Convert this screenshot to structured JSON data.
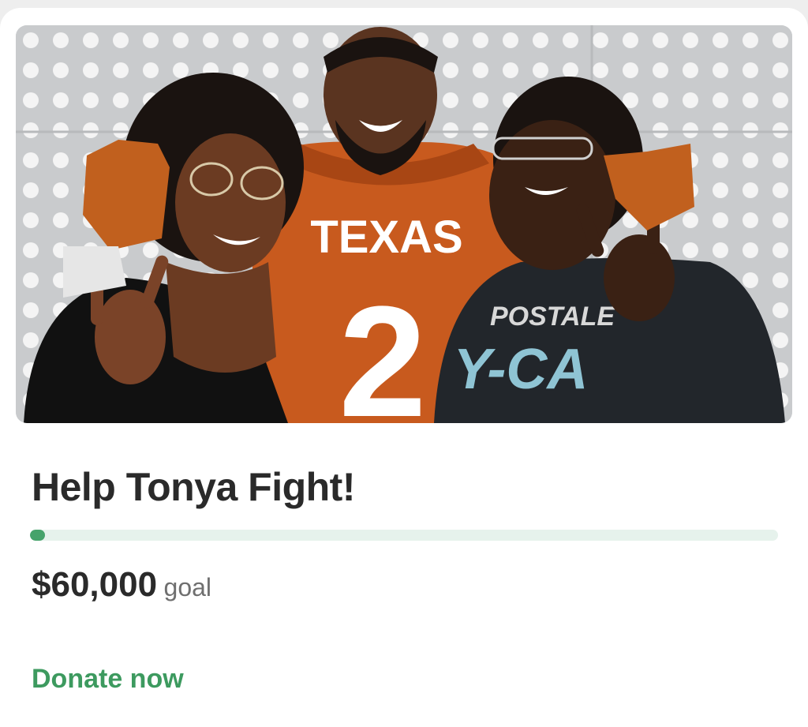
{
  "campaign": {
    "title": "Help Tonya Fight!",
    "photo_alt": "Campaign photo",
    "photo_text": {
      "jersey_team": "TEXAS",
      "jersey_number": "2",
      "shirt_line1": "POSTALE",
      "shirt_line2": "Y-CA"
    },
    "progress_fraction": 0.02,
    "goal_amount": "$60,000",
    "goal_label": "goal",
    "donate_label": "Donate now"
  },
  "colors": {
    "accent_green": "#3d9a5f",
    "progress_fill": "#46a36b",
    "progress_track": "#e6f2ec",
    "jersey_orange": "#c85a1e"
  }
}
